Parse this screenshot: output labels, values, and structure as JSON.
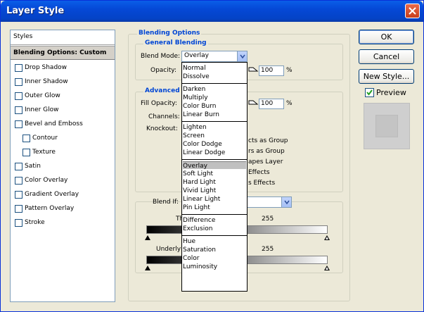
{
  "window": {
    "title": "Layer Style"
  },
  "sidebar": {
    "header": "Styles",
    "selected": "Blending Options: Custom",
    "items": [
      {
        "label": "Drop Shadow",
        "indent": false
      },
      {
        "label": "Inner Shadow",
        "indent": false
      },
      {
        "label": "Outer Glow",
        "indent": false
      },
      {
        "label": "Inner Glow",
        "indent": false
      },
      {
        "label": "Bevel and Emboss",
        "indent": false
      },
      {
        "label": "Contour",
        "indent": true
      },
      {
        "label": "Texture",
        "indent": true
      },
      {
        "label": "Satin",
        "indent": false
      },
      {
        "label": "Color Overlay",
        "indent": false
      },
      {
        "label": "Gradient Overlay",
        "indent": false
      },
      {
        "label": "Pattern Overlay",
        "indent": false
      },
      {
        "label": "Stroke",
        "indent": false
      }
    ]
  },
  "buttons": {
    "ok": "OK",
    "cancel": "Cancel",
    "new_style": "New Style...",
    "preview": "Preview"
  },
  "blending": {
    "section_title": "Blending Options",
    "general_title": "General Blending",
    "blend_mode_label": "Blend Mode:",
    "blend_mode_value": "Overlay",
    "opacity_label": "Opacity:",
    "opacity_value": "100",
    "percent": "%",
    "advanced_title": "Advanced",
    "fill_opacity_label": "Fill Opacity:",
    "fill_opacity_value": "100",
    "channels_label": "Channels:",
    "knockout_label": "Knockout:",
    "partial_texts": [
      "cts as Group",
      "rs as Group",
      "apes Layer",
      "Effects",
      "s Effects"
    ],
    "blend_if_label": "Blend If:",
    "this_layer_label": "Th",
    "this_layer_value": "255",
    "underlying_label": "Underlyi",
    "underlying_value": "255"
  },
  "dropdown": {
    "groups": [
      [
        "Normal",
        "Dissolve"
      ],
      [
        "Darken",
        "Multiply",
        "Color Burn",
        "Linear Burn"
      ],
      [
        "Lighten",
        "Screen",
        "Color Dodge",
        "Linear Dodge"
      ],
      [
        "Overlay",
        "Soft Light",
        "Hard Light",
        "Vivid Light",
        "Linear Light",
        "Pin Light"
      ],
      [
        "Difference",
        "Exclusion"
      ],
      [
        "Hue",
        "Saturation",
        "Color",
        "Luminosity"
      ]
    ],
    "highlighted": "Overlay"
  }
}
